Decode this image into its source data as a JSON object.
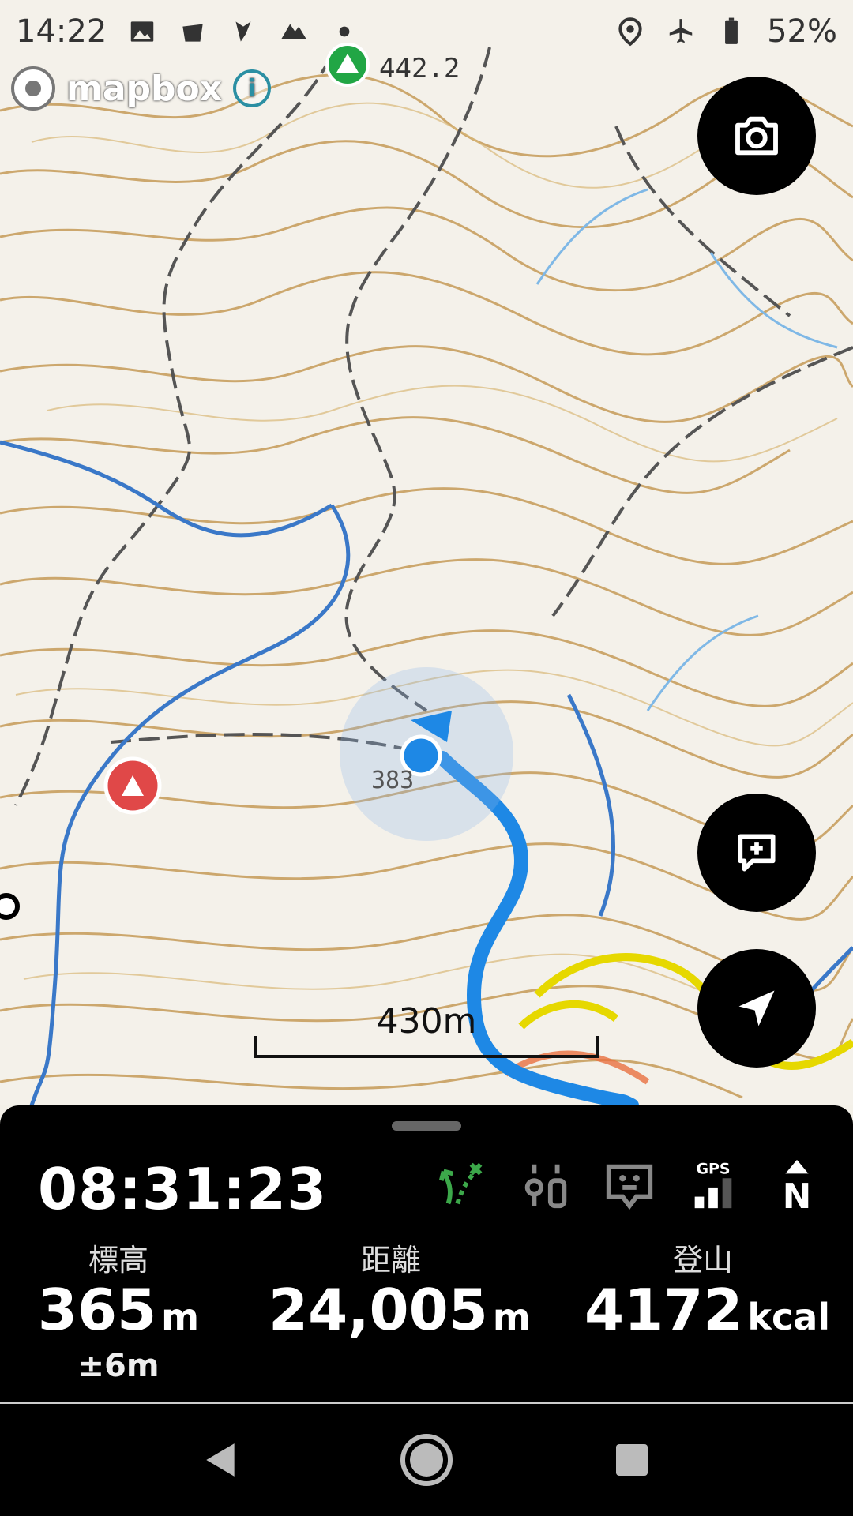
{
  "status_bar": {
    "time": "14:22",
    "battery_percent": "52%",
    "left_icons": [
      "image-icon",
      "notification-icon",
      "notification-icon-2",
      "mountain-icon",
      "dot-icon"
    ],
    "right_icons": [
      "location-icon",
      "airplane-mode-icon",
      "battery-icon"
    ]
  },
  "map": {
    "attribution": "mapbox",
    "info_label": "i",
    "peak_label": "442.2",
    "spot_elevation_label": "383",
    "scale_label": "430m",
    "route_color": "#1e88e5",
    "contour_color": "#c8a060"
  },
  "buttons": {
    "camera": "camera-icon",
    "add_memo": "add-comment-icon",
    "locate": "navigation-arrow-icon"
  },
  "panel": {
    "elapsed_time": "08:31:23",
    "icons": [
      "route-branch-icon",
      "settings-sliders-icon",
      "message-face-icon",
      "gps-signal-icon",
      "north-up-icon"
    ],
    "gps_label": "GPS",
    "north_label": "N",
    "stats": [
      {
        "label": "標高",
        "value": "365",
        "unit": "m",
        "sub": "±6m"
      },
      {
        "label": "距離",
        "value": "24,005",
        "unit": "m",
        "sub": ""
      },
      {
        "label": "登山",
        "value": "4172",
        "unit": "kcal",
        "sub": ""
      }
    ]
  },
  "navbar": [
    "back-icon",
    "home-icon",
    "recents-icon"
  ]
}
